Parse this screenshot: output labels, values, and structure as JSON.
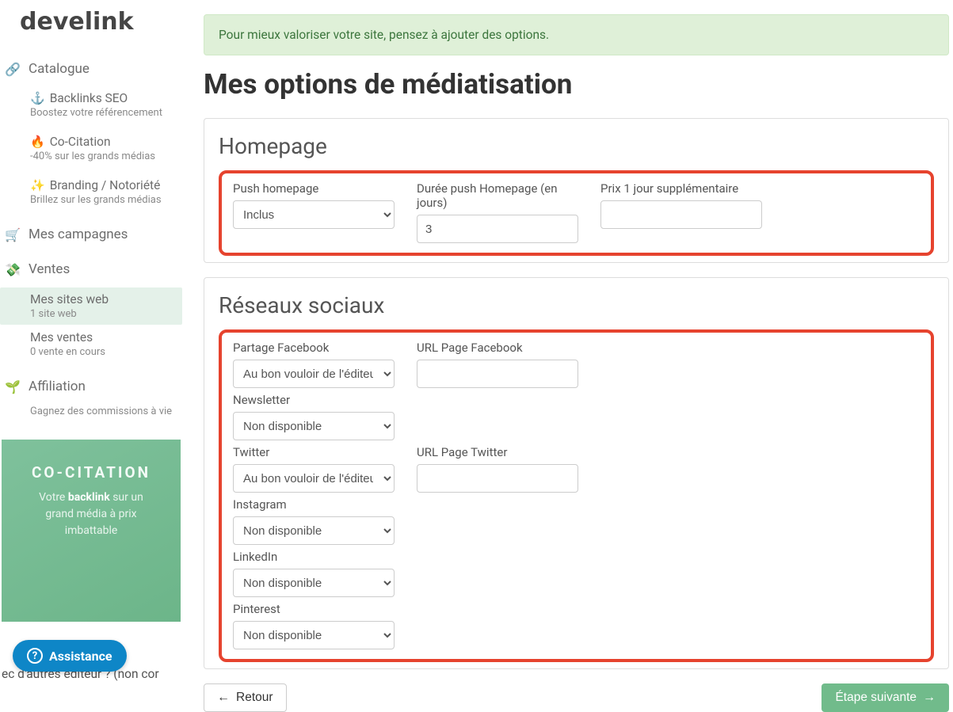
{
  "brand": "develink",
  "nav": {
    "catalogue": {
      "label": "Catalogue"
    },
    "backlinks": {
      "title": "Backlinks SEO",
      "desc": "Boostez votre référencement"
    },
    "cocitation": {
      "title": "Co-Citation",
      "desc": "-40% sur les grands médias"
    },
    "branding": {
      "title": "Branding / Notoriété",
      "desc": "Brillez sur les grands médias"
    },
    "mesCampagnes": {
      "label": "Mes campagnes"
    },
    "ventes": {
      "label": "Ventes"
    },
    "mesSites": {
      "title": "Mes sites web",
      "desc": "1 site web"
    },
    "mesVentes": {
      "title": "Mes ventes",
      "desc": "0 vente en cours"
    },
    "affiliation": {
      "label": "Affiliation",
      "desc": "Gagnez des commissions à vie"
    }
  },
  "promo": {
    "headline": "CO-CITATION",
    "line1a": "Votre ",
    "line1b": "backlink",
    "line1c": " sur un",
    "line2": "grand média à prix",
    "line3": "imbattable"
  },
  "assist": {
    "label": "Assistance"
  },
  "ghost": "ec d'autres éditeur ? (non cor",
  "banner": "Pour mieux valoriser votre site, pensez à ajouter des options.",
  "page_title": "Mes options de médiatisation",
  "homepage": {
    "heading": "Homepage",
    "push_label": "Push homepage",
    "push_value": "Inclus",
    "duree_label": "Durée push Homepage (en jours)",
    "duree_value": "3",
    "prix_label": "Prix 1 jour supplémentaire",
    "prix_value": ""
  },
  "social": {
    "heading": "Réseaux sociaux",
    "fb_label": "Partage Facebook",
    "fb_value": "Au bon vouloir de l'éditeur",
    "fb_url_label": "URL Page Facebook",
    "newsletter_label": "Newsletter",
    "newsletter_value": "Non disponible",
    "tw_label": "Twitter",
    "tw_value": "Au bon vouloir de l'éditeur",
    "tw_url_label": "URL Page Twitter",
    "ig_label": "Instagram",
    "ig_value": "Non disponible",
    "li_label": "LinkedIn",
    "li_value": "Non disponible",
    "pn_label": "Pinterest",
    "pn_value": "Non disponible"
  },
  "actions": {
    "back": "Retour",
    "next": "Étape suivante"
  }
}
